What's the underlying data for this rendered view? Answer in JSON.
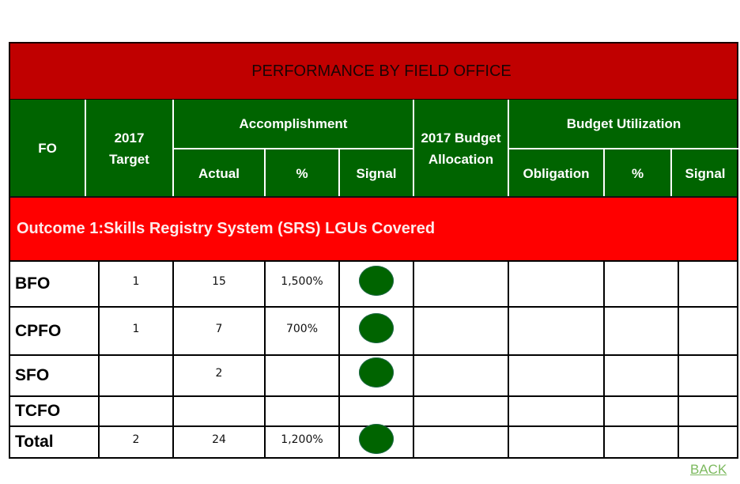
{
  "title": "PERFORMANCE BY FIELD OFFICE",
  "header": {
    "fo": "FO",
    "target": "2017 Target",
    "accomplishment": "Accomplishment",
    "actual": "Actual",
    "percent": "%",
    "signal": "Signal",
    "budget_allocation": "2017 Budget Allocation",
    "budget_utilization": "Budget Utilization",
    "obligation": "Obligation",
    "percent2": "%",
    "signal2": "Signal"
  },
  "outcome": "Outcome 1:Skills Registry System (SRS) LGUs Covered",
  "signal_color": "#006400",
  "rows": [
    {
      "fo": "BFO",
      "target": "1",
      "actual": "15",
      "percent": "1,500%",
      "signal": "green",
      "budget_allocation": "",
      "obligation": "",
      "budget_percent": "",
      "budget_signal": ""
    },
    {
      "fo": "CPFO",
      "target": "1",
      "actual": "7",
      "percent": "700%",
      "signal": "green",
      "budget_allocation": "",
      "obligation": "",
      "budget_percent": "",
      "budget_signal": ""
    },
    {
      "fo": "SFO",
      "target": "",
      "actual": "2",
      "percent": "",
      "signal": "green",
      "budget_allocation": "",
      "obligation": "",
      "budget_percent": "",
      "budget_signal": ""
    },
    {
      "fo": "TCFO",
      "target": "",
      "actual": "",
      "percent": "",
      "signal": "",
      "budget_allocation": "",
      "obligation": "",
      "budget_percent": "",
      "budget_signal": ""
    },
    {
      "fo": "Total",
      "target": "2",
      "actual": "24",
      "percent": "1,200%",
      "signal": "green",
      "budget_allocation": "",
      "obligation": "",
      "budget_percent": "",
      "budget_signal": ""
    }
  ],
  "back_link": "BACK"
}
